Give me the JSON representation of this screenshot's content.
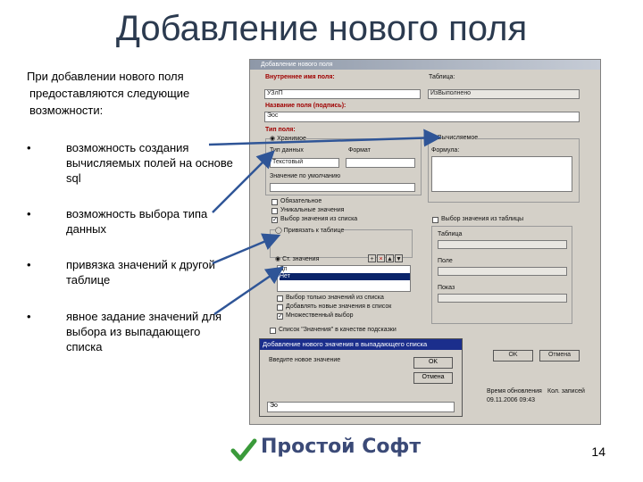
{
  "slide": {
    "title": "Добавление нового поля",
    "intro_lines": [
      "При добавлении нового поля",
      "предоставляются следующие",
      "возможности:"
    ],
    "bullets": [
      {
        "symbol": "•",
        "text": "возможность создания вычисляемых полей на основе sql"
      },
      {
        "symbol": "•",
        "text": "возможность выбора типа данных"
      },
      {
        "symbol": "•",
        "text": "привязка значений к другой таблице"
      },
      {
        "symbol": "•",
        "text": "явное задание значений для выбора из выпадающего списка"
      }
    ],
    "page_number": "14",
    "logo_text": "Простой Софт",
    "arrow_color": "#2f5597"
  },
  "dialog": {
    "title": "Добавление нового поля",
    "internal_name_label": "Внутреннее имя поля:",
    "internal_name_value": "УЗлП",
    "table_label": "Таблица:",
    "table_value": "ИзВыполнено",
    "caption_label": "Название поля (подпись):",
    "caption_value": "Эос",
    "field_type_label": "Тип поля:",
    "stored_radio": "Хранимое",
    "computed_label": "Вычисляемое",
    "data_type_label": "Тип данных",
    "data_type_value": "Текстовый",
    "format_label": "Формат",
    "default_label": "Значение по умолчанию",
    "formula_label": "Формула:",
    "options": [
      "Обязательное",
      "Уникальные значения",
      "Выбор значения из списка",
      "Привязать к таблице"
    ],
    "select_table_option": "Выбор значения из таблицы",
    "table_field_label": "Таблица",
    "field_field_label": "Поле",
    "display_label": "Показ",
    "value_list_label": "Ст. значения",
    "values": [
      "Дп",
      "Нет"
    ],
    "value_options": [
      "Выбор только значений из списка",
      "Добавлять новые значения в список",
      "Множественный выбор"
    ],
    "values_checkbox_label": "Список \"Значения\" в качестве подсказки",
    "ok_label": "OK",
    "cancel_label": "Отмена",
    "bottom_table_headers": [
      "Время обновления",
      "Кол. записей"
    ],
    "bottom_table_values": [
      "09.11.2006 09:43",
      ""
    ]
  },
  "sub_dialog": {
    "title": "Добавление нового значения в выпадающего списка",
    "prompt": "Введите новое значение",
    "ok_label": "OK",
    "cancel_label": "Отмена",
    "value": "Эо"
  }
}
